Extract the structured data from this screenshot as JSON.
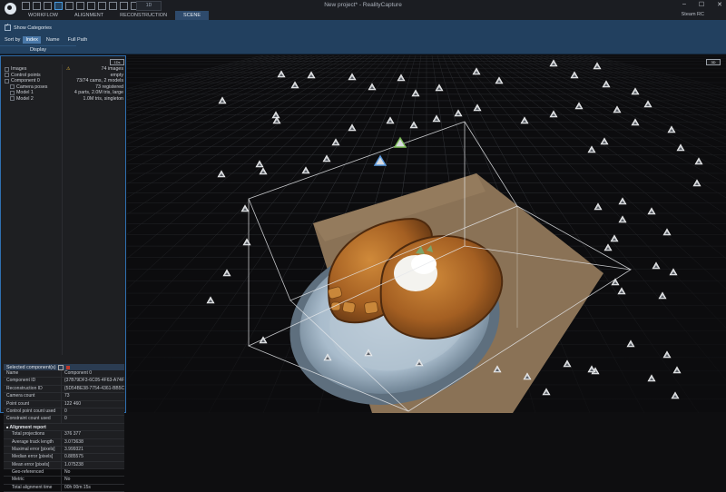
{
  "window": {
    "title": "New project* - RealityCapture",
    "layout_tag": "1D",
    "controls": [
      "–",
      "☐",
      "✕"
    ]
  },
  "menu": {
    "items": [
      "WORKFLOW",
      "ALIGNMENT",
      "RECONSTRUCTION",
      "SCENE"
    ],
    "active": "SCENE",
    "account": "Steam RC"
  },
  "ribbon": {
    "show_categories": "Show Categories",
    "sort_by": "Sort by",
    "sort_options": [
      "Index",
      "Name",
      "Full Path"
    ],
    "selected_sort": "Index",
    "group_label": "Display"
  },
  "left_panel": {
    "button": "1Ds",
    "tree": [
      {
        "label": "Images",
        "value": "74 images",
        "indent": false,
        "warn": true
      },
      {
        "label": "Control points",
        "value": "empty",
        "indent": false
      },
      {
        "label": "Component 0",
        "value": "73/74 cams, 2 models",
        "indent": false
      },
      {
        "label": "Camera poses",
        "value": "73 registered",
        "indent": true
      },
      {
        "label": "Model 1",
        "value": "4 parts, 2.0M tris, large",
        "indent": true
      },
      {
        "label": "Model 2",
        "value": "1.0M tris, singleton",
        "indent": true
      }
    ]
  },
  "properties": {
    "header": "Selected component(s)",
    "rows": [
      {
        "k": "Name",
        "v": "Component 0"
      },
      {
        "k": "Component ID",
        "v": "{37B79DF3-6C05-4F63-A74F-..."
      },
      {
        "k": "Reconstruction ID",
        "v": "{5D54BE38-7754-4361-BB5C-..."
      },
      {
        "k": "Camera count",
        "v": "73"
      },
      {
        "k": "Point count",
        "v": "122 460"
      },
      {
        "k": "Control point count used",
        "v": "0"
      },
      {
        "k": "Constraint count used",
        "v": "0"
      },
      {
        "k": "Alignment report",
        "v": "",
        "section": true
      },
      {
        "k": "Total projections",
        "v": "376 377",
        "indent": true
      },
      {
        "k": "Average track length",
        "v": "3.073638",
        "indent": true
      },
      {
        "k": "Maximal error [pixels]",
        "v": "3.999321",
        "indent": true
      },
      {
        "k": "Median error [pixels]",
        "v": "0.885575",
        "indent": true
      },
      {
        "k": "Mean error [pixels]",
        "v": "1.075238",
        "indent": true
      },
      {
        "k": "Geo-referenced",
        "v": "No",
        "indent": true
      },
      {
        "k": "Metric",
        "v": "No",
        "indent": true
      },
      {
        "k": "Total alignment time",
        "v": "00h:00m:15s",
        "indent": true
      }
    ]
  },
  "viewport": {
    "button": "3D"
  },
  "colors": {
    "accent": "#2f6fb0",
    "ribbon": "#22405f",
    "active_tab": "#2e4a6c"
  }
}
